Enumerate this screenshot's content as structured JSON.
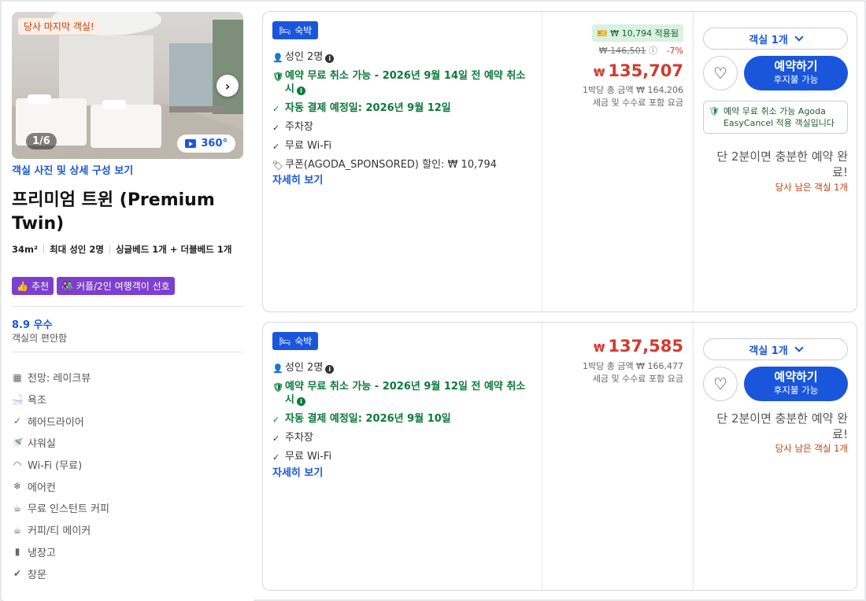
{
  "room": {
    "photo_badge": "당사 마지막 객실!",
    "photo_counter": "1/6",
    "photo_360": "360°",
    "photos_link": "객실 사진 및 상세 구성 보기",
    "title": "프리미엄 트윈 (Premium Twin)",
    "size": "34m²",
    "occupancy": "최대 성인 2명",
    "beds": "싱글베드 1개 + 더블베드 1개",
    "tags": [
      "추천",
      "커플/2인 여행객이 선호"
    ],
    "score": "8.9 우수",
    "score_sub": "객실의 편안함",
    "amenities": [
      {
        "icon": "view-icon",
        "label": "전망: 레이크뷰"
      },
      {
        "icon": "bathtub-icon",
        "label": "욕조"
      },
      {
        "icon": "check-icon",
        "label": "헤어드라이어"
      },
      {
        "icon": "shower-icon",
        "label": "샤워실"
      },
      {
        "icon": "wifi-icon",
        "label": "Wi-Fi (무료)"
      },
      {
        "icon": "air-conditioner-icon",
        "label": "에어컨"
      },
      {
        "icon": "coffee-machine-icon",
        "label": "무료 인스턴트 커피"
      },
      {
        "icon": "coffee-cup-icon",
        "label": "커피/티 메이커"
      },
      {
        "icon": "fridge-icon",
        "label": "냉장고"
      },
      {
        "icon": "window-icon",
        "label": "창문"
      }
    ]
  },
  "offers": [
    {
      "stay_label": "숙박",
      "guests": "성인 2명",
      "free_cancel": "예약 무료 취소 가능 - 2026년 9월 14일 전 예약 취소 시",
      "autopay": "자동 결제 예정일: 2026년 9월 12일",
      "parking": "주차장",
      "wifi": "무료 Wi-Fi",
      "coupon": "쿠폰(AGODA_SPONSORED) 할인: ₩ 10,794",
      "more": "자세히 보기",
      "coupon_applied": "₩ 10,794 적용됨",
      "original_price": "₩ 146,501",
      "discount": "-7%",
      "currency": "₩",
      "price": "135,707",
      "total_note": "1박당 총 금액 ₩ 164,206",
      "tax_note": "세금 및 수수료 포함 요금",
      "rooms_select": "객실 1개",
      "book_label": "예약하기",
      "book_sub": "후지불 가능",
      "easycancel": "예약 무료 취소 가능 Agoda EasyCancel 적용 객실입니다",
      "enough": "단 2분이면 충분한 예약 완료!",
      "left_rooms": "당사 남은 객실 1개"
    },
    {
      "stay_label": "숙박",
      "guests": "성인 2명",
      "free_cancel": "예약 무료 취소 가능 - 2026년 9월 12일 전 예약 취소 시",
      "autopay": "자동 결제 예정일: 2026년 9월 10일",
      "parking": "주차장",
      "wifi": "무료 Wi-Fi",
      "more": "자세히 보기",
      "currency": "₩",
      "price": "137,585",
      "total_note": "1박당 총 금액 ₩ 166,477",
      "tax_note": "세금 및 수수료 포함 요금",
      "rooms_select": "객실 1개",
      "book_label": "예약하기",
      "book_sub": "후지불 가능",
      "enough": "단 2분이면 충분한 예약 완료!",
      "left_rooms": "당사 남은 객실 1개"
    }
  ]
}
